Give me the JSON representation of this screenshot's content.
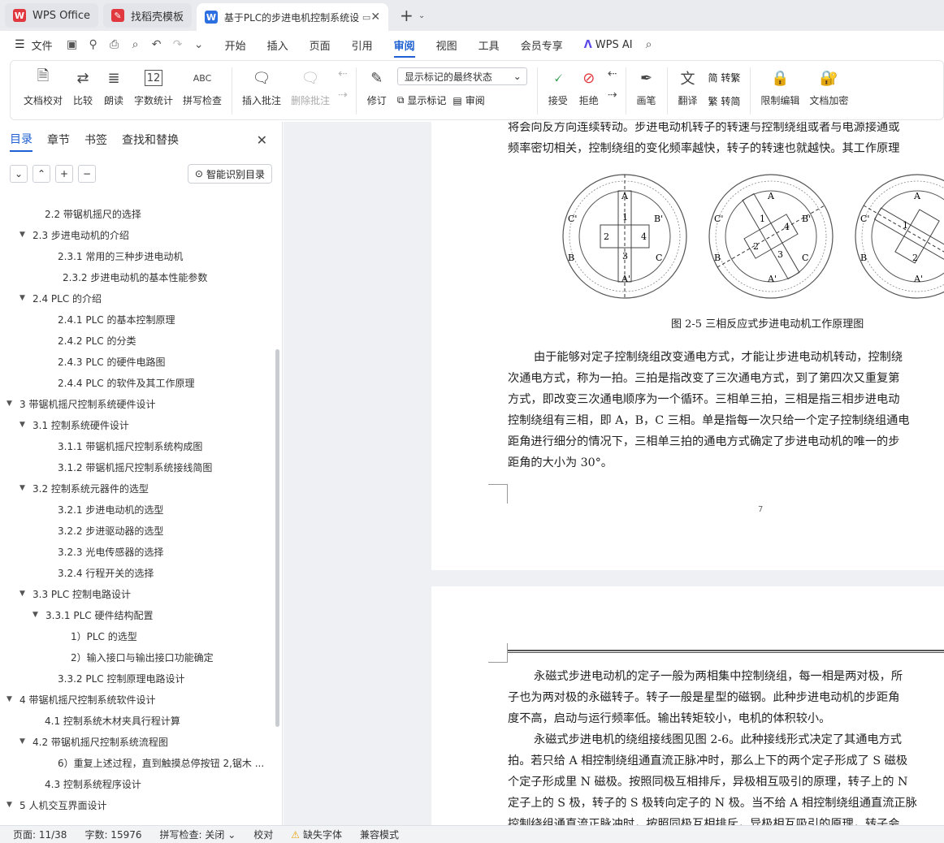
{
  "tabs": [
    {
      "label": "WPS Office",
      "icon": "wps-logo-icon"
    },
    {
      "label": "找稻壳模板",
      "icon": "docer-icon"
    },
    {
      "label": "基于PLC的步进电机控制系统设",
      "icon": "wps-writer-icon"
    }
  ],
  "menu": [
    "文件",
    "开始",
    "插入",
    "页面",
    "引用",
    "审阅",
    "视图",
    "工具",
    "会员专享",
    "WPS AI"
  ],
  "ribbon": {
    "doc_check": "文档校对",
    "compare": "比较",
    "read_aloud": "朗读",
    "word_count": "字数统计",
    "spell_check": "拼写检查",
    "insert_comment": "插入批注",
    "delete_comment": "删除批注",
    "revise": "修订",
    "markup_select": "显示标记的最终状态",
    "show_markup": "显示标记",
    "review": "审阅",
    "accept": "接受",
    "reject": "拒绝",
    "pen": "画笔",
    "translate": "翻译",
    "to_traditional": "简 转繁",
    "to_simplified": "繁 转简",
    "restrict_edit": "限制编辑",
    "encrypt": "文档加密",
    "spell_icon_text": "ABC",
    "wordcount_icon_text": "12"
  },
  "sidebar": {
    "tabs": [
      "目录",
      "章节",
      "书签",
      "查找和替换"
    ],
    "smart_toc": "智能识别目录",
    "toc": [
      {
        "text": "2.2 带锯机摇尺的选择",
        "indent": 55,
        "arrow": ""
      },
      {
        "text": "2.3 步进电动机的介绍",
        "indent": 40,
        "arrow": "▼"
      },
      {
        "text": "2.3.1 常用的三种步进电动机",
        "indent": 71,
        "arrow": ""
      },
      {
        "text": "2.3.2 步进电动机的基本性能参数",
        "indent": 77,
        "arrow": ""
      },
      {
        "text": "2.4 PLC 的介绍",
        "indent": 40,
        "arrow": "▼"
      },
      {
        "text": "2.4.1 PLC 的基本控制原理",
        "indent": 71,
        "arrow": ""
      },
      {
        "text": "2.4.2 PLC 的分类",
        "indent": 71,
        "arrow": ""
      },
      {
        "text": "2.4.3 PLC 的硬件电路图",
        "indent": 71,
        "arrow": ""
      },
      {
        "text": "2.4.4 PLC 的软件及其工作原理",
        "indent": 71,
        "arrow": ""
      },
      {
        "text": "3  带锯机摇尺控制系统硬件设计",
        "indent": 24,
        "arrow": "▼"
      },
      {
        "text": "3.1  控制系统硬件设计",
        "indent": 40,
        "arrow": "▼"
      },
      {
        "text": "3.1.1 带锯机摇尺控制系统构成图",
        "indent": 71,
        "arrow": ""
      },
      {
        "text": "3.1.2 带锯机摇尺控制系统接线简图",
        "indent": 71,
        "arrow": ""
      },
      {
        "text": "3.2  控制系统元器件的选型",
        "indent": 40,
        "arrow": "▼"
      },
      {
        "text": "3.2.1 步进电动机的选型",
        "indent": 71,
        "arrow": ""
      },
      {
        "text": "3.2.2  步进驱动器的选型",
        "indent": 71,
        "arrow": ""
      },
      {
        "text": "3.2.3 光电传感器的选择",
        "indent": 71,
        "arrow": ""
      },
      {
        "text": "3.2.4  行程开关的选择",
        "indent": 71,
        "arrow": ""
      },
      {
        "text": "3.3 PLC 控制电路设计",
        "indent": 40,
        "arrow": "▼"
      },
      {
        "text": "3.3.1 PLC 硬件结构配置",
        "indent": 56,
        "arrow": "▼"
      },
      {
        "text": "1）PLC 的选型",
        "indent": 87,
        "arrow": ""
      },
      {
        "text": "2）输入接口与输出接口功能确定",
        "indent": 87,
        "arrow": ""
      },
      {
        "text": "3.3.2 PLC 控制原理电路设计",
        "indent": 71,
        "arrow": ""
      },
      {
        "text": "4  带锯机摇尺控制系统软件设计",
        "indent": 24,
        "arrow": "▼"
      },
      {
        "text": "4.1  控制系统木材夹具行程计算",
        "indent": 55,
        "arrow": ""
      },
      {
        "text": "4.2 带锯机摇尺控制系统流程图",
        "indent": 40,
        "arrow": "▼"
      },
      {
        "text": "6）重复上述过程，直到触摸总停按钮 2,锯木 ...",
        "indent": 71,
        "arrow": ""
      },
      {
        "text": "4.3  控制系统程序设计",
        "indent": 55,
        "arrow": ""
      },
      {
        "text": "5  人机交互界面设计",
        "indent": 24,
        "arrow": "▼"
      }
    ]
  },
  "page1": {
    "lines_top": [
      "将会向反方向连续转动。步进电动机转子的转速与控制绕组或者与电源接通或",
      "频率密切相关，控制绕组的变化频率越快，转子的转速也就越快。其工作原理"
    ],
    "figure_caption": "图 2-5   三相反应式步进电动机工作原理图",
    "figure_labels": {
      "A": "A",
      "A_prime": "A'",
      "B": "B",
      "B_prime": "B'",
      "C": "C",
      "C_prime": "C'",
      "r1": "1",
      "r2": "2",
      "r3": "3",
      "r4": "4"
    },
    "paragraph": [
      "由于能够对定子控制绕组改变通电方式，才能让步进电动机转动，控制绕",
      "次通电方式，称为一拍。三拍是指改变了三次通电方式，到了第四次又重复第",
      "方式，即改变三次通电顺序为一个循环。三相单三拍，三相是指三相步进电动",
      "控制绕组有三相，即 A，B，C 三相。单是指每一次只给一个定子控制绕组通电",
      "距角进行细分的情况下，三相单三拍的通电方式确定了步进电动机的唯一的步",
      "距角的大小为 30°。"
    ],
    "page_number": "7"
  },
  "page2": {
    "p1": [
      "永磁式步进电动机的定子一般为两相集中控制绕组，每一相是两对极，所",
      "子也为两对极的永磁转子。转子一般是星型的磁钢。此种步进电动机的步距角",
      "度不高，启动与运行频率低。输出转矩较小，电机的体积较小。"
    ],
    "p2": [
      "永磁式步进电机的绕组接线图见图 2-6。此种接线形式决定了其通电方式",
      "拍。若只给 A 相控制绕组通直流正脉冲时，那么上下的两个定子形成了 S 磁极",
      "个定子形成里 N 磁极。按照同极互相排斥，异极相互吸引的原理，转子上的 N",
      "定子上的 S 极，转子的 S 极转向定子的 N 极。当不给 A 相控制绕组通直流正脉",
      "控制绕组通直流正脉冲时，按照同极互相排斥，异极相互吸引的原理，转子会"
    ]
  },
  "status": {
    "page": "页面: 11/38",
    "words": "字数: 15976",
    "spell": "拼写检查: 关闭",
    "proof": "校对",
    "missing_font": "缺失字体",
    "compat": "兼容模式"
  },
  "colors": {
    "accent": "#1e5fd1",
    "wps_red": "#e0383e"
  }
}
